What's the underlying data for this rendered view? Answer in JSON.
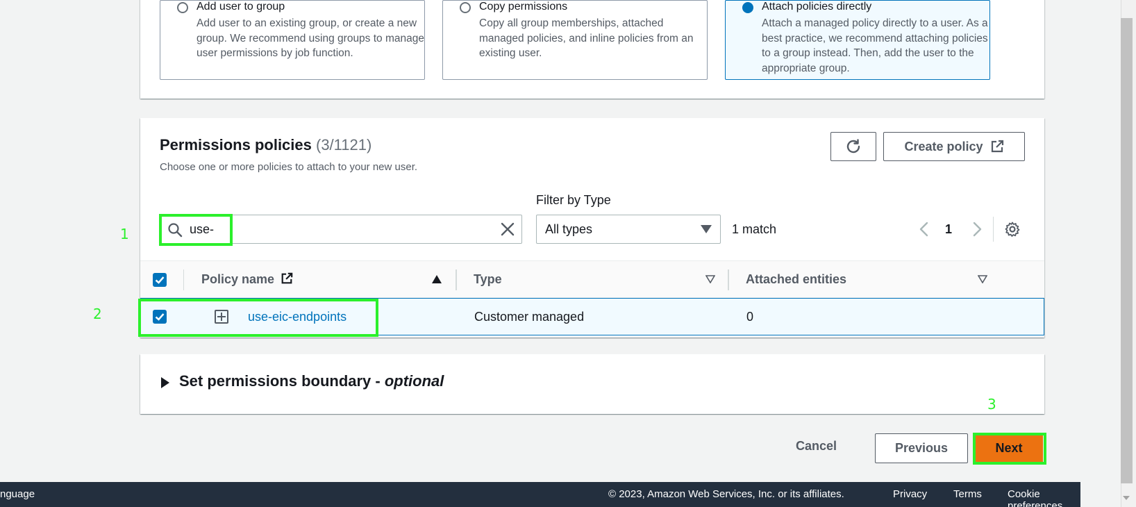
{
  "options": [
    {
      "title": "Add user to group",
      "desc": "Add user to an existing group, or create a new group. We recommend using groups to manage user permissions by job function.",
      "selected": false
    },
    {
      "title": "Copy permissions",
      "desc": "Copy all group memberships, attached managed policies, and inline policies from an existing user.",
      "selected": false
    },
    {
      "title": "Attach policies directly",
      "desc": "Attach a managed policy directly to a user. As a best practice, we recommend attaching policies to a group instead. Then, add the user to the appropriate group.",
      "selected": true
    }
  ],
  "permissions": {
    "title": "Permissions policies",
    "count": "(3/1121)",
    "description": "Choose one or more policies to attach to your new user.",
    "create_policy_label": "Create policy",
    "search_value": "use-",
    "filter_label": "Filter by Type",
    "filter_value": "All types",
    "match_count": "1 match",
    "page_number": "1",
    "columns": {
      "policy_name": "Policy name",
      "type": "Type",
      "attached_entities": "Attached entities"
    },
    "rows": [
      {
        "policy_name": "use-eic-endpoints",
        "type": "Customer managed",
        "attached_entities": "0",
        "checked": true
      }
    ]
  },
  "boundary": {
    "title": "Set permissions boundary - ",
    "title_italic": "optional"
  },
  "actions": {
    "cancel": "Cancel",
    "previous": "Previous",
    "next": "Next"
  },
  "annotations": {
    "one": "1",
    "two": "2",
    "three": "3",
    "highlight_color": "#2cf02c"
  },
  "footer": {
    "language": "nguage",
    "copyright": "© 2023, Amazon Web Services, Inc. or its affiliates.",
    "privacy": "Privacy",
    "terms": "Terms",
    "cookies": "Cookie preferences"
  },
  "colors": {
    "accent": "#0073bb",
    "primary_button": "#ec7211",
    "footer_bg": "#232f3e"
  }
}
